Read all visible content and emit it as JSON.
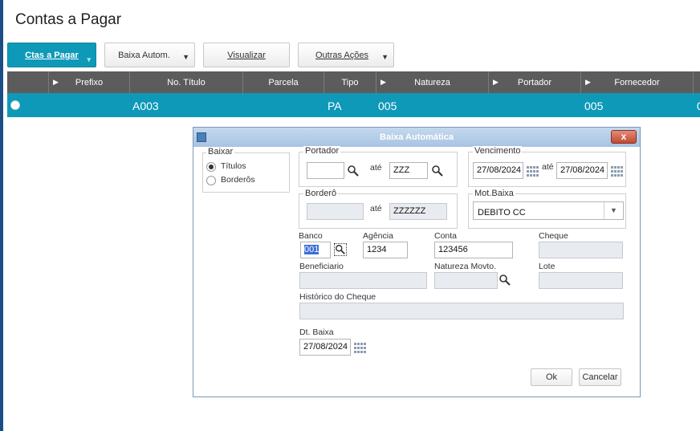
{
  "page": {
    "title": "Contas a Pagar"
  },
  "toolbar": {
    "ctas_label": "Ctas a Pagar",
    "baixa_label": "Baixa Autom.",
    "visualizar_label": "Visualizar",
    "outras_label": "Outras Ações"
  },
  "grid": {
    "columns": [
      "Prefixo",
      "No. Título",
      "Parcela",
      "Tipo",
      "Natureza",
      "Portador",
      "Fornecedor"
    ],
    "row": {
      "no_titulo": "A003",
      "tipo": "PA",
      "natureza": "005",
      "fornecedor": "005",
      "extra": "0"
    }
  },
  "dialog": {
    "title": "Baixa Automática",
    "close": "x",
    "baixar": {
      "label": "Baixar",
      "opt1": "Títulos",
      "opt2": "Borderôs",
      "selected": "Títulos"
    },
    "portador": {
      "label": "Portador",
      "from": "",
      "ate": "até",
      "to": "ZZZ"
    },
    "vencimento": {
      "label": "Vencimento",
      "from": "27/08/2024",
      "ate": "até",
      "to": "27/08/2024"
    },
    "bordero": {
      "label": "Borderô",
      "from": "",
      "ate": "até",
      "to": "ZZZZZZ"
    },
    "motbaixa": {
      "label": "Mot.Baixa",
      "value": "DEBITO CC"
    },
    "banco": {
      "label": "Banco",
      "value": "001"
    },
    "agencia": {
      "label": "Agência",
      "value": "1234"
    },
    "conta": {
      "label": "Conta",
      "value": "123456"
    },
    "cheque": {
      "label": "Cheque",
      "value": ""
    },
    "beneficiario": {
      "label": "Beneficiario",
      "value": ""
    },
    "natureza_movto": {
      "label": "Natureza Movto.",
      "value": ""
    },
    "lote": {
      "label": "Lote",
      "value": ""
    },
    "historico": {
      "label": "Histórico do Cheque",
      "value": ""
    },
    "dtbaixa": {
      "label": "Dt. Baixa",
      "value": "27/08/2024"
    },
    "ok": "Ok",
    "cancelar": "Cancelar"
  }
}
